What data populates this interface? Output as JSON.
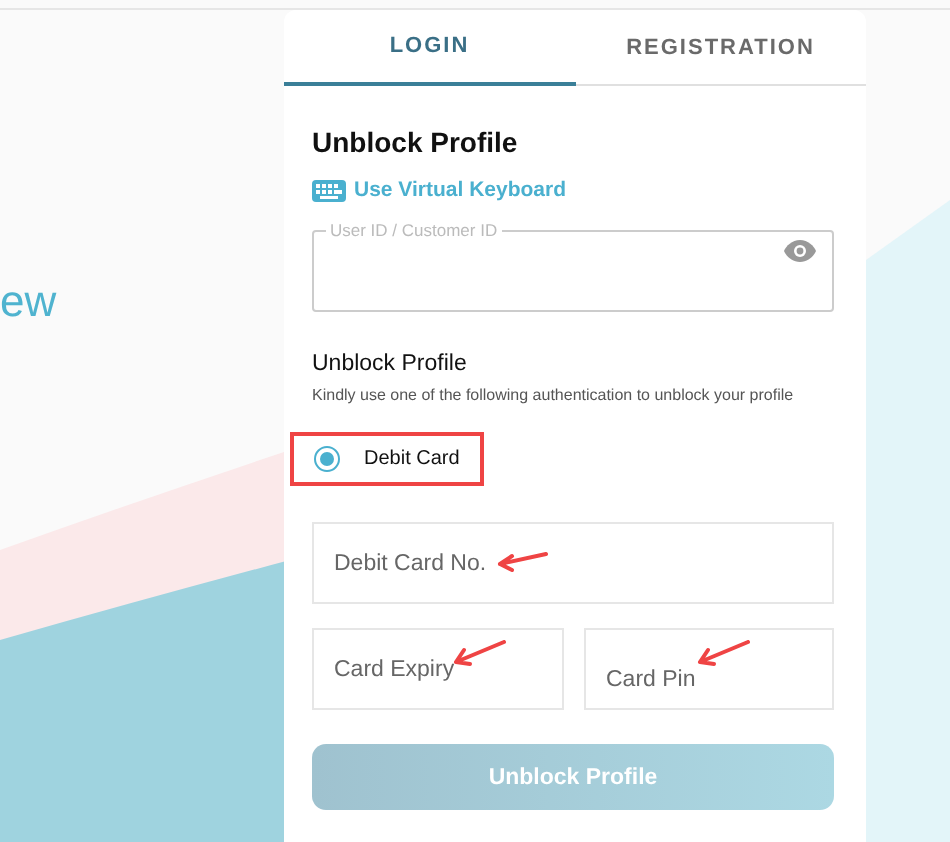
{
  "background_text": "ew",
  "tabs": [
    {
      "label": "LOGIN",
      "selected": true
    },
    {
      "label": "REGISTRATION",
      "selected": false
    }
  ],
  "title": "Unblock Profile",
  "virtual_keyboard_link": "Use Virtual Keyboard",
  "user_id_field": {
    "label": "User ID / Customer ID"
  },
  "section_title": "Unblock Profile",
  "section_hint": "Kindly use one of the following authentication to unblock your profile",
  "options": [
    {
      "label": "Debit Card",
      "selected": true
    }
  ],
  "card_number_field": {
    "placeholder": "Debit Card No."
  },
  "expiry_field": {
    "placeholder": "Card Expiry"
  },
  "pin_field": {
    "placeholder": "Card Pin"
  },
  "submit_button": {
    "label": "Unblock Profile",
    "disabled": true
  }
}
